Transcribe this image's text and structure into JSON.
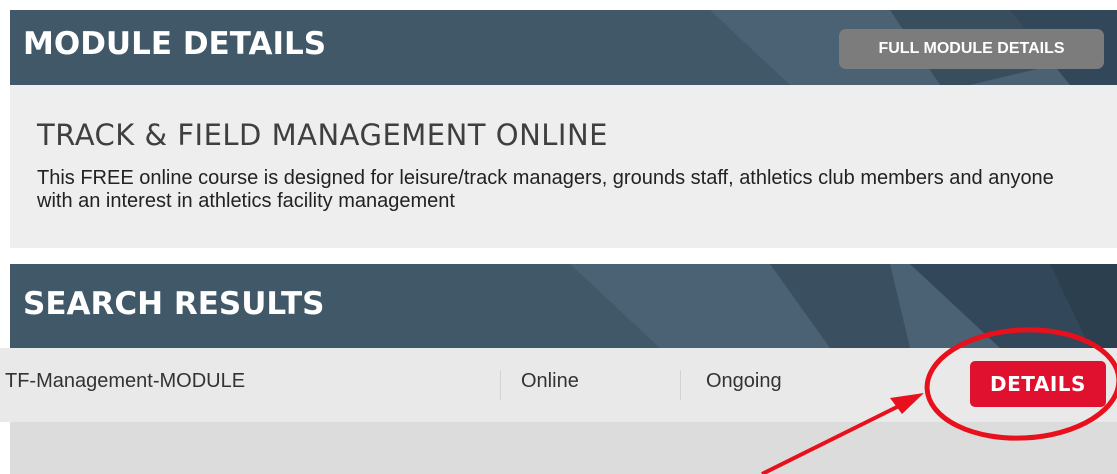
{
  "module_section": {
    "header_title": "MODULE DETAILS",
    "full_details_label": "FULL MODULE DETAILS"
  },
  "course": {
    "title": "TRACK & FIELD MANAGEMENT ONLINE",
    "description": "This FREE online course is designed for leisure/track managers, grounds staff, athletics club members and anyone with an interest in athletics facility management"
  },
  "search_section": {
    "header_title": "SEARCH RESULTS",
    "results": [
      {
        "name": "TF-Management-MODULE",
        "delivery": "Online",
        "date": "Ongoing",
        "action_label": "DETAILS"
      }
    ]
  },
  "colors": {
    "header_band": "#415869",
    "details_button": "#e0102f",
    "annotation": "#e8101c",
    "full_details_button": "#7c7c7c"
  }
}
